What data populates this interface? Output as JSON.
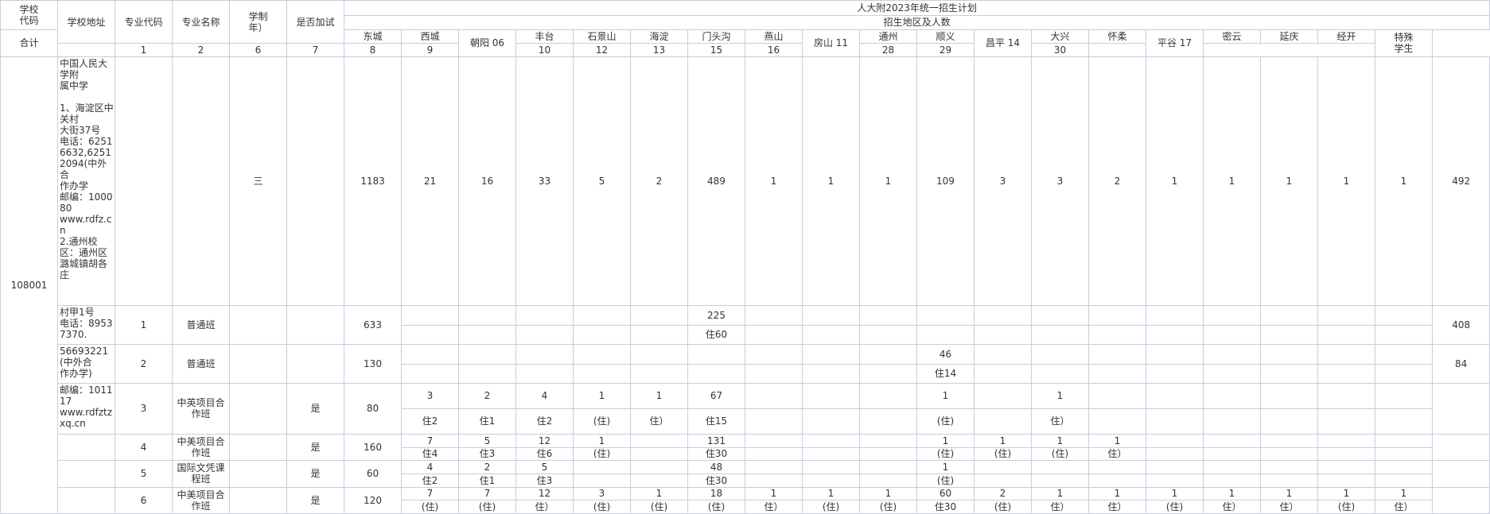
{
  "title": "人大附2023年统一招生计划",
  "headers": {
    "school_code": "学校\n代码",
    "school_address": "学校地址",
    "major_code": "专业代码",
    "major_name": "专业名称",
    "years": "学制\n年）",
    "extra_fee": "是否加试",
    "region_group": "招生地区及人数",
    "total": "合计",
    "special": "特殊\n学生"
  },
  "regions": [
    {
      "name": "东城",
      "code": "1"
    },
    {
      "name": "西城",
      "code": "2"
    },
    {
      "name": "朝阳 06",
      "code": ""
    },
    {
      "name": "丰台",
      "code": "6"
    },
    {
      "name": "石景山",
      "code": "7"
    },
    {
      "name": "海淀",
      "code": "8"
    },
    {
      "name": "门头沟",
      "code": "9"
    },
    {
      "name": "燕山",
      "code": "10"
    },
    {
      "name": "房山 11",
      "code": ""
    },
    {
      "name": "通州",
      "code": "12"
    },
    {
      "name": "顺义",
      "code": "13"
    },
    {
      "name": "昌平 14",
      "code": ""
    },
    {
      "name": "大兴",
      "code": "15"
    },
    {
      "name": "怀柔",
      "code": "16"
    },
    {
      "name": "平谷 17",
      "code": ""
    },
    {
      "name": "密云",
      "code": "28"
    },
    {
      "name": "延庆",
      "code": "29"
    },
    {
      "name": "经开",
      "code": "30"
    }
  ],
  "school_code_value": "108001",
  "address_lines": [
    "中国人民大学附",
    "属中学",
    "",
    "1、海淀区中关村",
    "大街37号",
    "电话：62516632,62512094(中外合",
    "作办学",
    "邮编：100080",
    "www.rdfz.cn",
    "2.通州校区：通州区潞城镇胡各庄",
    "村甲1号",
    "电话：89537370.",
    "56693221(中外合",
    "作办学)",
    "邮编：101117",
    "www.rdfztzxq.cn",
    "",
    ""
  ],
  "summary": {
    "years": "三",
    "total": "1183",
    "values": [
      "21",
      "16",
      "33",
      "5",
      "2",
      "489",
      "1",
      "1",
      "1",
      "109",
      "3",
      "3",
      "2",
      "1",
      "1",
      "1",
      "1",
      "1"
    ],
    "special": "492"
  },
  "programs": [
    {
      "code": "1",
      "name": "普通班",
      "extra": "",
      "total": "633",
      "special": "408",
      "top": [
        "",
        "",
        "",
        "",
        "",
        "225",
        "",
        "",
        "",
        "",
        "",
        "",
        "",
        "",
        "",
        "",
        "",
        ""
      ],
      "bottom": [
        "",
        "",
        "",
        "",
        "",
        "住60",
        "",
        "",
        "",
        "",
        "",
        "",
        "",
        "",
        "",
        "",
        "",
        ""
      ]
    },
    {
      "code": "2",
      "name": "普通班",
      "extra": "",
      "total": "130",
      "special": "84",
      "top": [
        "",
        "",
        "",
        "",
        "",
        "",
        "",
        "",
        "",
        "46",
        "",
        "",
        "",
        "",
        "",
        "",
        "",
        ""
      ],
      "bottom": [
        "",
        "",
        "",
        "",
        "",
        "",
        "",
        "",
        "",
        "住14",
        "",
        "",
        "",
        "",
        "",
        "",
        "",
        ""
      ]
    },
    {
      "code": "3",
      "name": "中英项目合作班",
      "extra": "是",
      "total": "80",
      "special": "",
      "top": [
        "3",
        "2",
        "4",
        "1",
        "1",
        "67",
        "",
        "",
        "",
        "1",
        "",
        "1",
        "",
        "",
        "",
        "",
        "",
        ""
      ],
      "bottom": [
        "住2",
        "住1",
        "住2",
        "(住)",
        "住）",
        "住15",
        "",
        "",
        "",
        "(住)",
        "",
        "住）",
        "",
        "",
        "",
        "",
        "",
        ""
      ]
    },
    {
      "code": "4",
      "name": "中美项目合作班",
      "extra": "是",
      "total": "160",
      "special": "",
      "top": [
        "7",
        "5",
        "12",
        "1",
        "",
        "131",
        "",
        "",
        "",
        "1",
        "1",
        "1",
        "1",
        "",
        "",
        "",
        "",
        ""
      ],
      "bottom": [
        "住4",
        "住3",
        "住6",
        "(住)",
        "",
        "住30",
        "",
        "",
        "",
        "(住)",
        "(住)",
        "(住)",
        "住）",
        "",
        "",
        "",
        "",
        ""
      ]
    },
    {
      "code": "5",
      "name": "国际文凭课程班",
      "extra": "是",
      "total": "60",
      "special": "",
      "top": [
        "4",
        "2",
        "5",
        "",
        "",
        "48",
        "",
        "",
        "",
        "1",
        "",
        "",
        "",
        "",
        "",
        "",
        "",
        ""
      ],
      "bottom": [
        "住2",
        "住1",
        "住3",
        "",
        "",
        "住30",
        "",
        "",
        "",
        "(住)",
        "",
        "",
        "",
        "",
        "",
        "",
        "",
        ""
      ]
    },
    {
      "code": "6",
      "name": "中美项目合作班",
      "extra": "是",
      "total": "120",
      "special": "",
      "top": [
        "7",
        "7",
        "12",
        "3",
        "1",
        "18",
        "1",
        "1",
        "1",
        "60",
        "2",
        "1",
        "1",
        "1",
        "1",
        "1",
        "1",
        "1"
      ],
      "bottom": [
        "(住)",
        "(住)",
        "住）",
        "(住)",
        "(住)",
        "(住)",
        "住）",
        "(住)",
        "(住)",
        "住30",
        "(住)",
        "住）",
        "住）",
        "(住)",
        "住）",
        "住）",
        "(住)",
        "住）"
      ]
    }
  ]
}
